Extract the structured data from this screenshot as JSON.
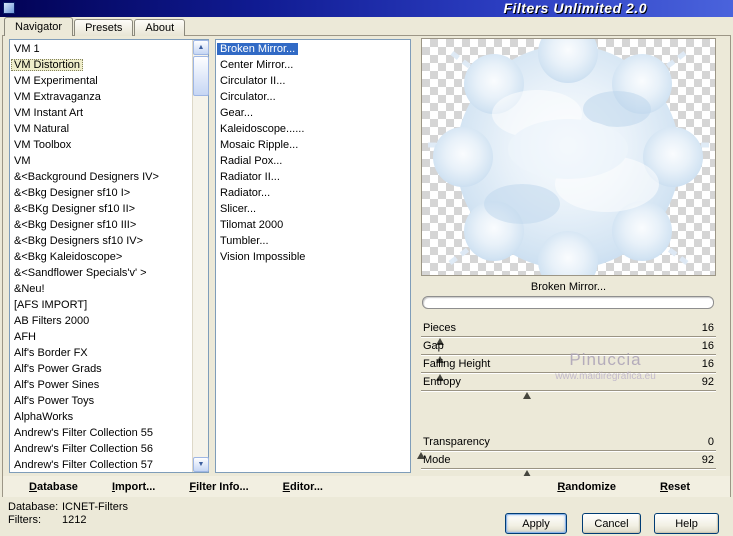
{
  "window": {
    "title": "Filters Unlimited 2.0"
  },
  "tabs": [
    {
      "label": "Navigator",
      "active": true
    },
    {
      "label": "Presets",
      "active": false
    },
    {
      "label": "About",
      "active": false
    }
  ],
  "icons": {
    "scroll_up": "▲",
    "scroll_down": "▼"
  },
  "categories": {
    "selected": "VM Distortion",
    "items": [
      "VM 1",
      "VM Distortion",
      "VM Experimental",
      "VM Extravaganza",
      "VM Instant Art",
      "VM Natural",
      "VM Toolbox",
      "VM",
      "&<Background Designers IV>",
      "&<Bkg Designer sf10 I>",
      "&<BKg Designer sf10 II>",
      "&<Bkg Designer sf10 III>",
      "&<Bkg Designers sf10 IV>",
      "&<Bkg Kaleidoscope>",
      "&<Sandflower Specials'v' >",
      "&Neu!",
      "[AFS IMPORT]",
      "AB Filters 2000",
      "AFH",
      "Alf's Border FX",
      "Alf's Power Grads",
      "Alf's Power Sines",
      "Alf's Power Toys",
      "AlphaWorks",
      "Andrew's Filter Collection 55",
      "Andrew's Filter Collection 56",
      "Andrew's Filter Collection 57"
    ]
  },
  "filters_list": {
    "selected": "Broken Mirror...",
    "items": [
      "Broken Mirror...",
      "Center Mirror...",
      "Circulator II...",
      "Circulator...",
      "Gear...",
      "Kaleidoscope......",
      "Mosaic Ripple...",
      "Radial Pox...",
      "Radiator II...",
      "Radiator...",
      "Slicer...",
      "Tilomat 2000",
      "Tumbler...",
      "Vision Impossible"
    ]
  },
  "preview": {
    "caption": "Broken Mirror..."
  },
  "params_top": [
    {
      "label": "Pieces",
      "value": 16
    },
    {
      "label": "Gap",
      "value": 16
    },
    {
      "label": "Falling Height",
      "value": 16
    },
    {
      "label": "Entropy",
      "value": 92
    }
  ],
  "params_bottom": [
    {
      "label": "Transparency",
      "value": 0
    },
    {
      "label": "Mode",
      "value": 92
    }
  ],
  "slider_max": 255,
  "watermark": {
    "name": "Pinuccia",
    "url": "www.maidiregrafica.eu"
  },
  "toolbar_left": [
    {
      "label": "Database"
    },
    {
      "label": "Import..."
    },
    {
      "label": "Filter Info..."
    },
    {
      "label": "Editor..."
    }
  ],
  "toolbar_right": [
    {
      "label": "Randomize"
    },
    {
      "label": "Reset"
    }
  ],
  "status": {
    "database_label": "Database:",
    "database_value": "ICNET-Filters",
    "filters_label": "Filters:",
    "filters_value": "1212"
  },
  "buttons": {
    "apply": "Apply",
    "cancel": "Cancel",
    "help": "Help"
  },
  "colors": {
    "selection": "#316AC5",
    "category_selection": "#EFEDCB",
    "titlebar_left": "#020255",
    "titlebar_right": "#4A63DC"
  }
}
